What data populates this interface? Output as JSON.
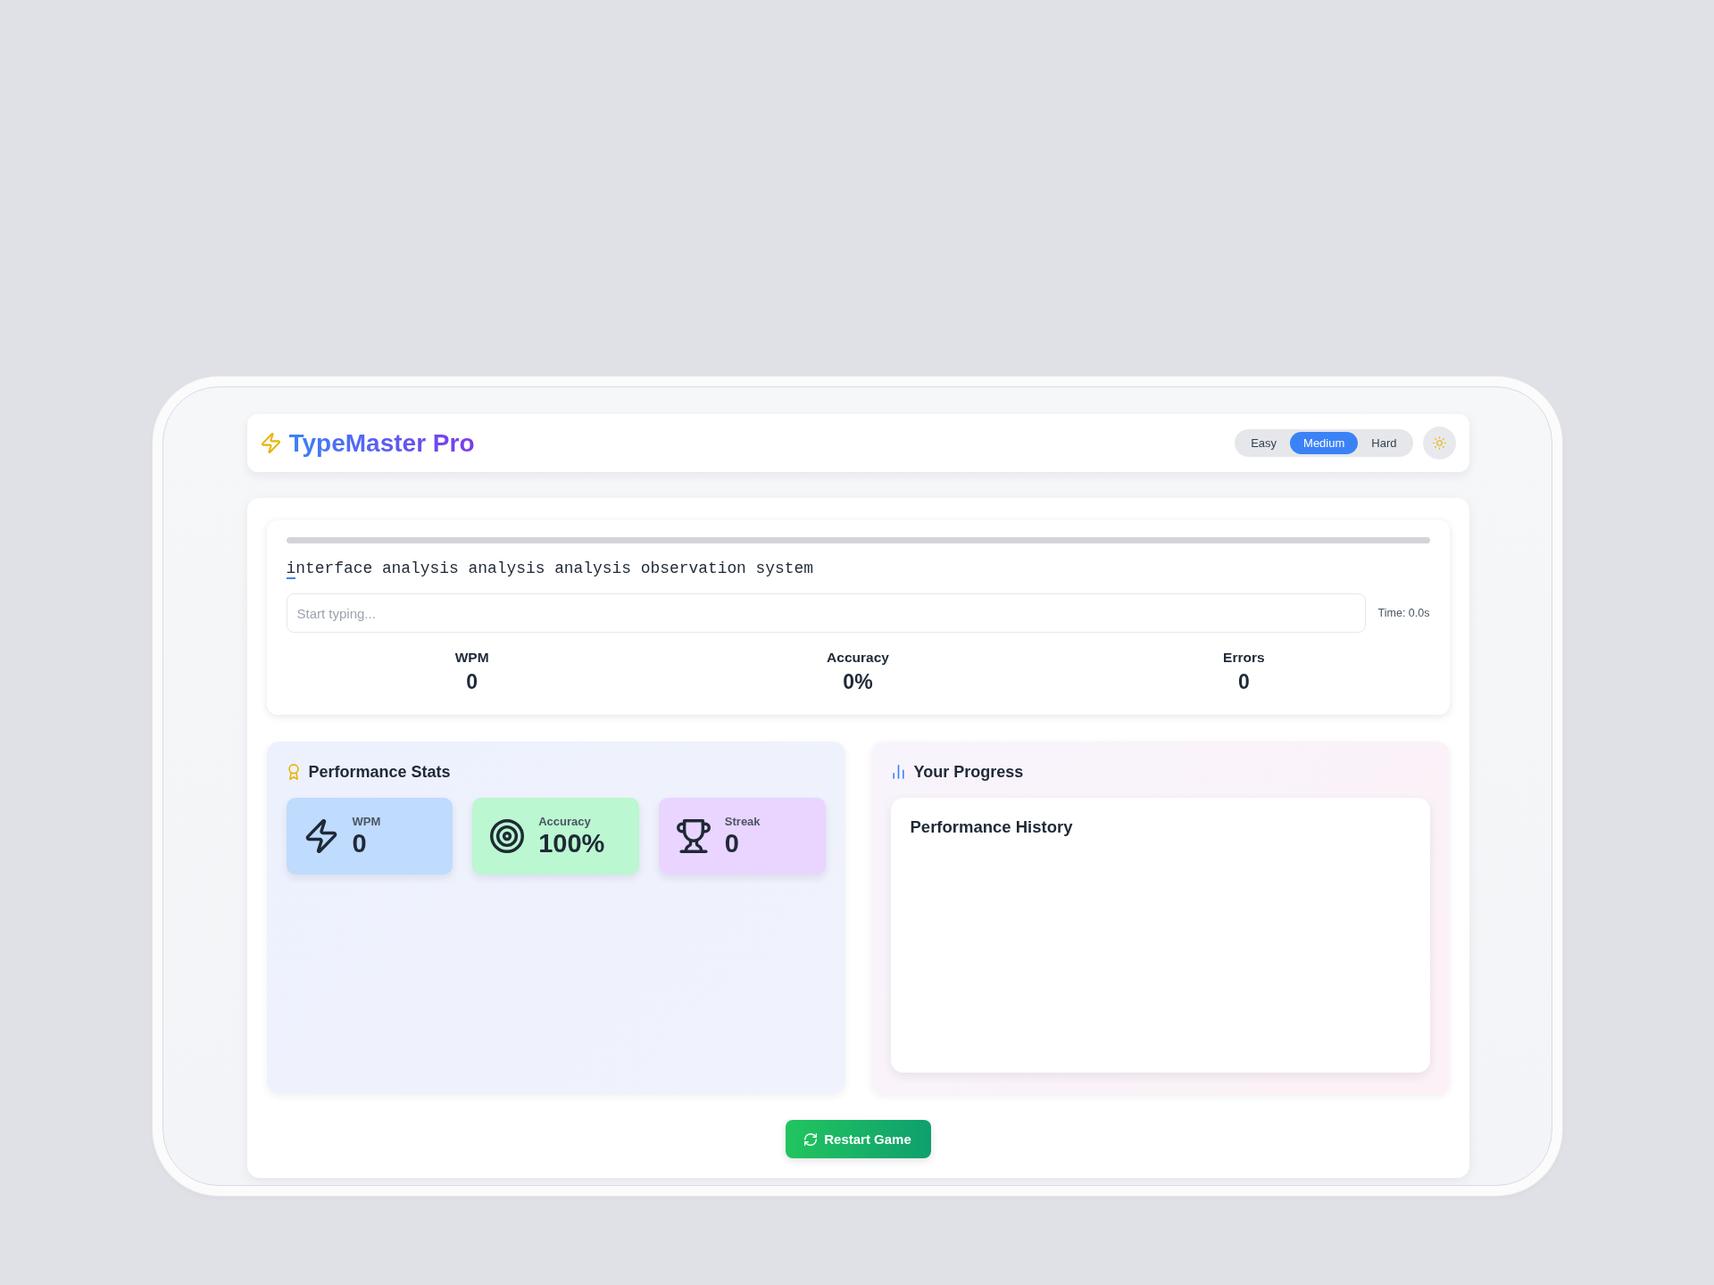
{
  "header": {
    "title": "TypeMaster Pro",
    "difficulty": [
      {
        "label": "Easy",
        "selected": false
      },
      {
        "label": "Medium",
        "selected": true
      },
      {
        "label": "Hard",
        "selected": false
      }
    ]
  },
  "typing_test": {
    "progress": {
      "level": 0
    },
    "passage": {
      "current": "i",
      "upcoming": "nterface analysis analysis analysis observation system"
    },
    "input": {
      "placeholder": "Start typing..."
    },
    "timer": "Time: 0.0s",
    "stats": [
      {
        "label": "WPM",
        "value": "0"
      },
      {
        "label": "Accuracy",
        "value": "0%"
      },
      {
        "label": "Errors",
        "value": "0"
      }
    ]
  },
  "performance_stats": {
    "title": "Performance Stats",
    "cards": [
      {
        "kind": "speed",
        "label": "WPM",
        "value": "0",
        "color": "#bfdbfe"
      },
      {
        "kind": "accuracy",
        "label": "Accuracy",
        "value": "100%",
        "color": "#bbf7d0"
      },
      {
        "kind": "streak",
        "label": "Streak",
        "value": "0",
        "color": "#e9d5ff"
      }
    ]
  },
  "progress_panel": {
    "title": "Your Progress",
    "chart": {
      "title": "Performance History"
    }
  },
  "restart_button": {
    "label": "Restart Game"
  }
}
